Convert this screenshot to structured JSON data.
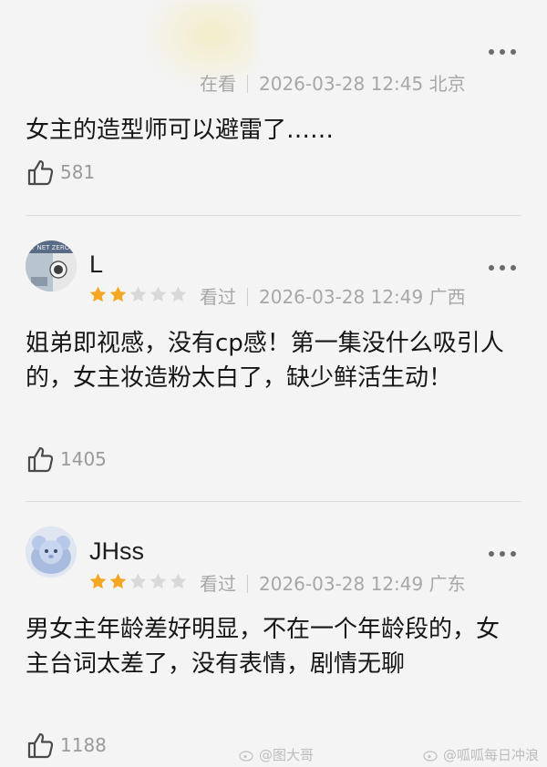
{
  "comments": [
    {
      "username": "",
      "rating": 0,
      "status": "在看",
      "datetime": "2026-03-28 12:45",
      "location": "北京",
      "text": "女主的造型师可以避雷了……",
      "likes": "581"
    },
    {
      "username": "L",
      "rating": 2,
      "status": "看过",
      "datetime": "2026-03-28 12:49",
      "location": "广西",
      "text": "姐弟即视感，没有cp感！第一集没什么吸引人的，女主妆造粉太白了，缺少鲜活生动！",
      "likes": "1405"
    },
    {
      "username": "JHss",
      "rating": 2,
      "status": "看过",
      "datetime": "2026-03-28 12:49",
      "location": "广东",
      "text": "男女主年龄差好明显，不在一个年龄段的，女主台词太差了，没有表情，剧情无聊",
      "likes": "1188"
    }
  ],
  "watermarks": {
    "left": "@图大哥",
    "right": "@呱呱每日冲浪"
  },
  "colors": {
    "star_filled": "#f5a623",
    "star_empty": "#d9d9d9",
    "meta": "#a7a7a7",
    "background": "#f4f4f4"
  }
}
